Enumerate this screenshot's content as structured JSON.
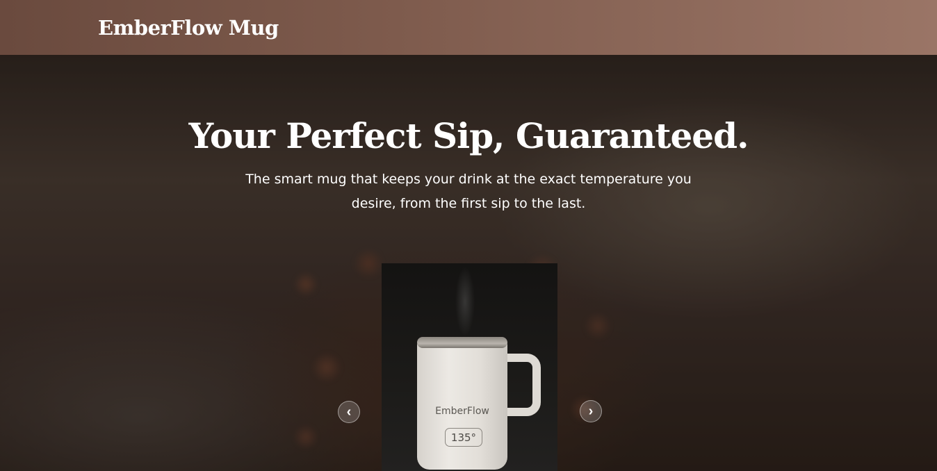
{
  "header": {
    "brand": "EmberFlow Mug"
  },
  "hero": {
    "headline": "Your Perfect Sip, Guaranteed.",
    "subheadline": "The smart mug that keeps your drink at the exact temperature you desire, from the first sip to the last."
  },
  "carousel": {
    "product": {
      "brand_text": "EmberFlow",
      "temperature_display": "135°"
    },
    "prev_label": "‹",
    "next_label": "›"
  },
  "colors": {
    "header_gradient_start": "#6a4a3e",
    "header_gradient_end": "#9a7566",
    "text_on_dark": "#ffffff"
  }
}
